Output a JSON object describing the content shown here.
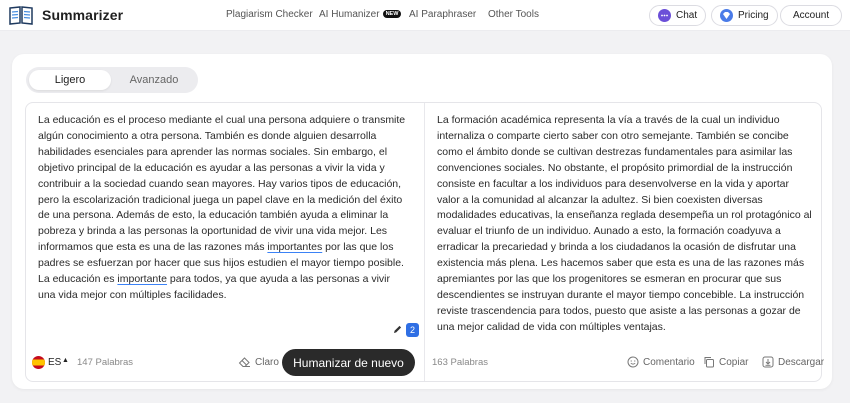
{
  "app": {
    "name": "Summarizer"
  },
  "nav": {
    "items": [
      {
        "label": "Plagiarism Checker"
      },
      {
        "label": "AI Humanizer",
        "badge": "NEW"
      },
      {
        "label": "AI Paraphraser"
      },
      {
        "label": "Other Tools"
      }
    ]
  },
  "header_actions": {
    "chat": "Chat",
    "pricing": "Pricing",
    "account": "Account"
  },
  "modes": {
    "active": "Ligero",
    "inactive": "Avanzado"
  },
  "input": {
    "seg1": "La educación es el proceso mediante el cual una persona adquiere o transmite algún conocimiento a otra persona. También es donde alguien desarrolla habilidades esenciales para aprender las normas sociales. Sin embargo, el objetivo principal de la educación es ayudar a las personas a vivir la vida y contribuir a la sociedad cuando sean mayores. Hay varios tipos de educación, pero la escolarización tradicional juega un papel clave en la medición del éxito de una persona. Además de esto, la educación también ayuda a eliminar la pobreza y brinda a las personas la oportunidad de vivir una vida mejor. Les informamos que esta es una de las razones más ",
    "u1": "importantes",
    "seg2": " por las que los padres se esfuerzan por hacer que sus hijos estudien el mayor tiempo posible. La educación es ",
    "u2": "importante",
    "seg3": " para todos, ya que ayuda a las personas a vivir una vida mejor con múltiples facilidades.",
    "suggestions_count": "2",
    "language_code": "ES",
    "word_count": "147 Palabras",
    "clear_label": "Claro",
    "humanize_label": "Humanizar de nuevo"
  },
  "output": {
    "text": "La formación académica representa la vía a través de la cual un individuo internaliza o comparte cierto saber con otro semejante. También se concibe como el ámbito donde se cultivan destrezas fundamentales para asimilar las convenciones sociales. No obstante, el propósito primordial de la instrucción consiste en facultar a los individuos para desenvolverse en la vida y aportar valor a la comunidad al alcanzar la adultez. Si bien coexisten diversas modalidades educativas, la enseñanza reglada desempeña un rol protagónico al evaluar el triunfo de un individuo. Aunado a esto, la formación coadyuva a erradicar la precariedad y brinda a los ciudadanos la ocasión de disfrutar una existencia más plena. Les hacemos saber que esta es una de las razones más apremiantes por las que los progenitores se esmeran en procurar que sus descendientes se instruyan durante el mayor tiempo concebible. La instrucción reviste trascendencia para todos, puesto que asiste a las personas a gozar de una mejor calidad de vida con múltiples ventajas.",
    "word_count": "163 Palabras",
    "comment_label": "Comentario",
    "copy_label": "Copiar",
    "download_label": "Descargar"
  },
  "colors": {
    "accent_button": "#2a2a2a",
    "suggestion_badge": "#2f6fe4",
    "underline": "#3b82f6"
  }
}
